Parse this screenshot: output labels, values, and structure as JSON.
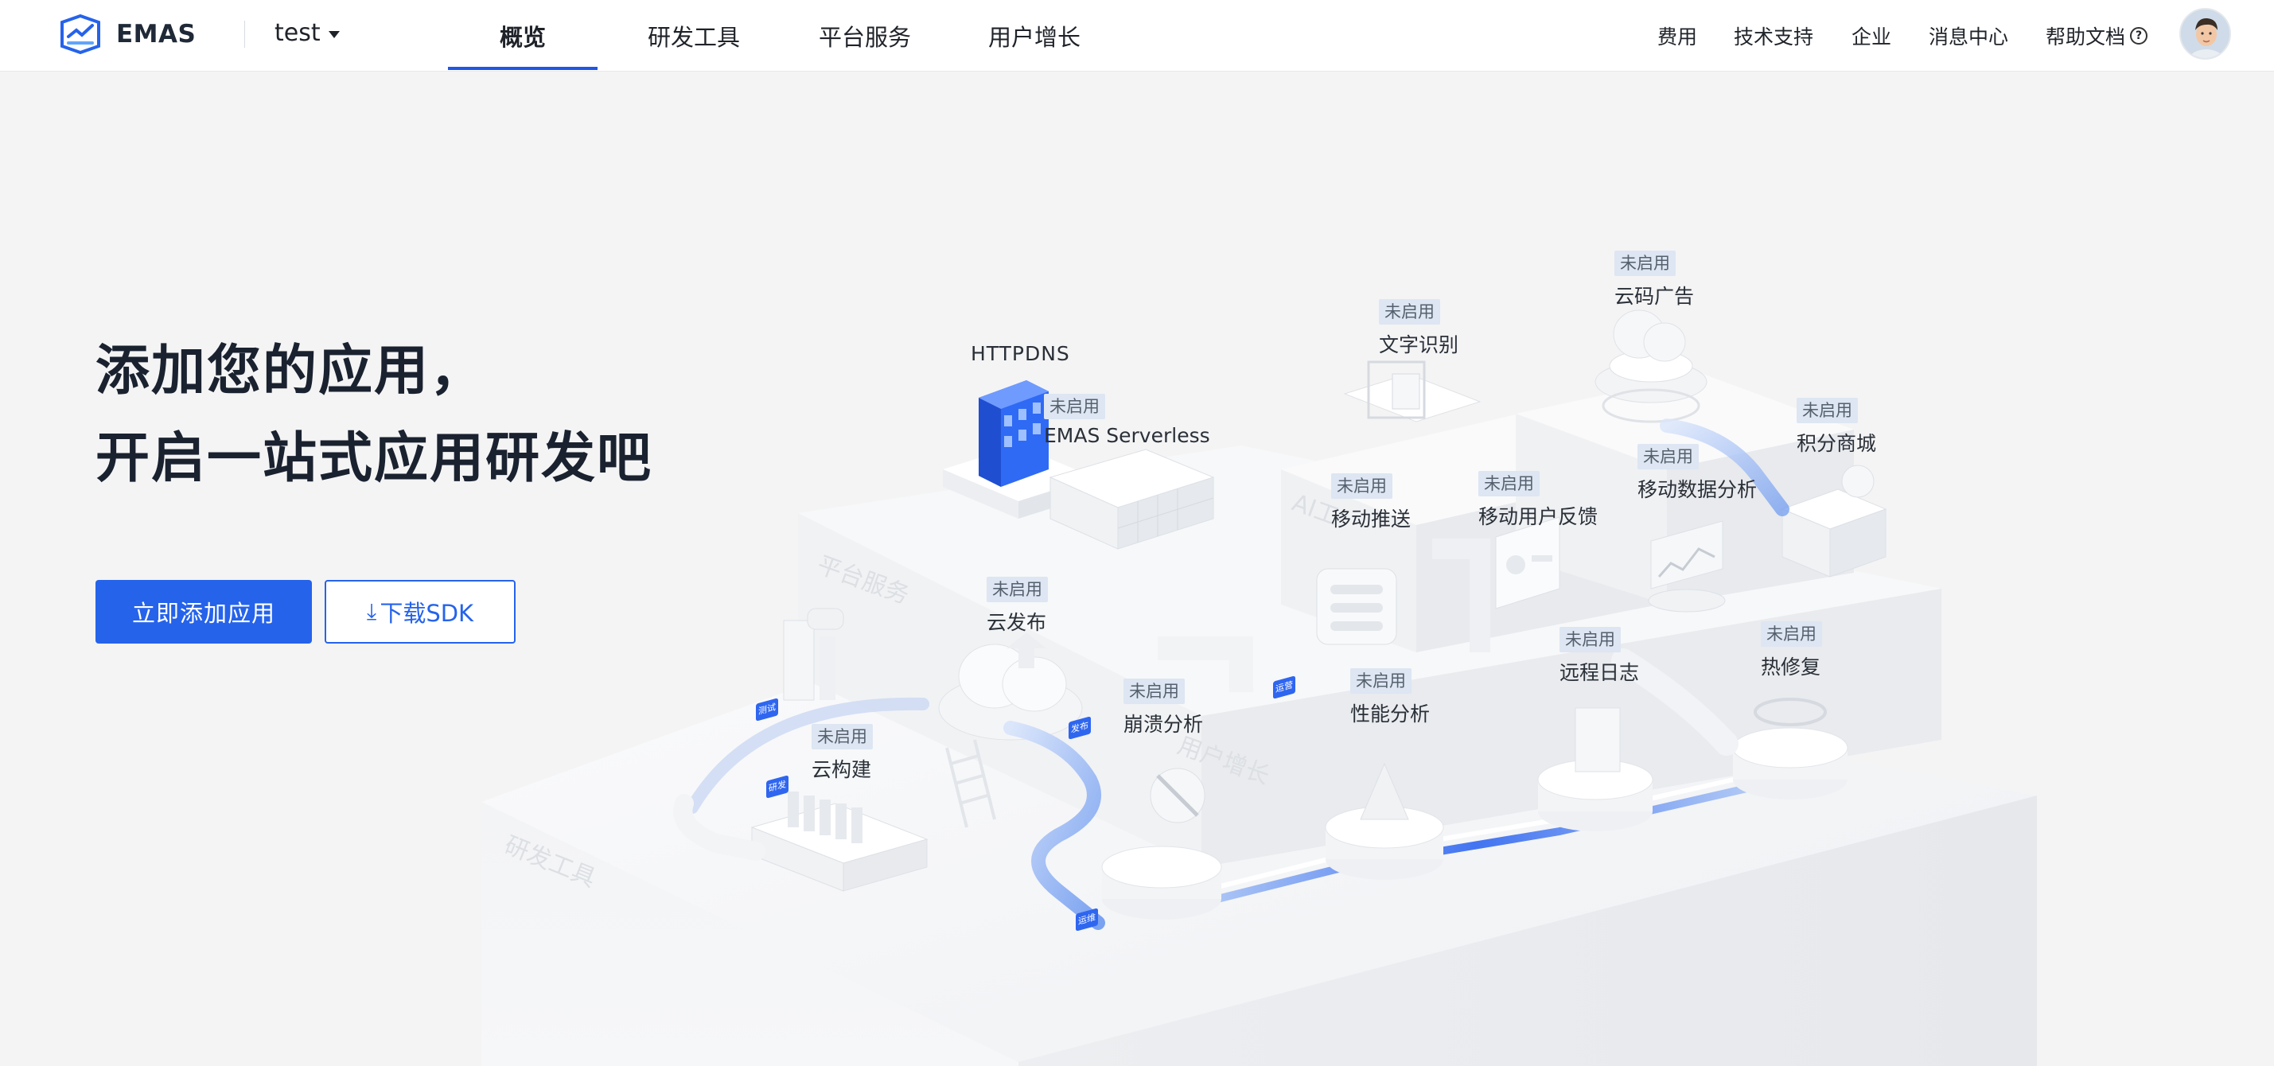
{
  "brand": {
    "name": "EMAS",
    "accent": "#2563eb"
  },
  "project": {
    "name": "test"
  },
  "nav": {
    "tabs": [
      {
        "label": "概览",
        "active": true
      },
      {
        "label": "研发工具",
        "active": false
      },
      {
        "label": "平台服务",
        "active": false
      },
      {
        "label": "用户增长",
        "active": false
      }
    ],
    "right_links": [
      "费用",
      "技术支持",
      "企业",
      "消息中心",
      "帮助文档"
    ],
    "help_icon": "question-circle-icon"
  },
  "hero": {
    "title_line1": "添加您的应用，",
    "title_line2": "开启一站式应用研发吧",
    "primary_button": "立即添加应用",
    "download_button": "下载SDK"
  },
  "services": {
    "status_label": "未启用",
    "httpdns": "HTTPDNS",
    "serverless": "EMAS Serverless",
    "ocr": "文字识别",
    "cloud_ads": "云码广告",
    "points_mall": "积分商城",
    "push": "移动推送",
    "feedback": "移动用户反馈",
    "analytics": "移动数据分析",
    "cloud_publish": "云发布",
    "crash": "崩溃分析",
    "performance": "性能分析",
    "remote_log": "远程日志",
    "hotfix": "热修复",
    "cloud_build": "云构建"
  },
  "platform_labels": {
    "platform_services": "平台服务",
    "user_growth": "用户增长",
    "dev_tools": "研发工具",
    "ai": "AI工"
  },
  "step_chips": {
    "test": "测试",
    "dev": "研发",
    "release": "发布",
    "ops": "运维",
    "operate": "运营"
  }
}
